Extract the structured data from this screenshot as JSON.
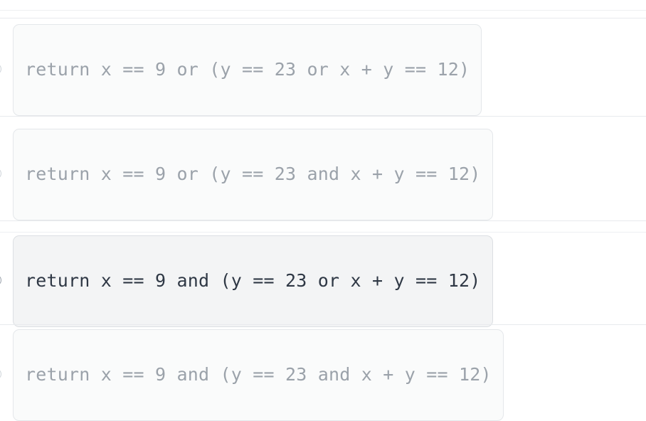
{
  "screen": {
    "background_color": "#ffffff",
    "separator_color": "#e8eaed"
  },
  "question_options": {
    "selected_index": 2,
    "unselected_text_color": "#9ba2aa",
    "selected_text_color": "#2f3845",
    "box_fill_color": "#fafbfb",
    "selected_box_fill_color": "#f3f4f5",
    "box_border_color": "#e4e7ea",
    "items": [
      {
        "id": "option-a",
        "code": "return x == 9 or (y == 23 or x + y == 12)",
        "selected": false
      },
      {
        "id": "option-b",
        "code": "return x == 9 or (y == 23 and x + y == 12)",
        "selected": false
      },
      {
        "id": "option-c",
        "code": "return x == 9 and (y == 23 or x + y == 12)",
        "selected": true
      },
      {
        "id": "option-d",
        "code": "return x == 9 and (y == 23 and x + y == 12)",
        "selected": false
      }
    ]
  }
}
